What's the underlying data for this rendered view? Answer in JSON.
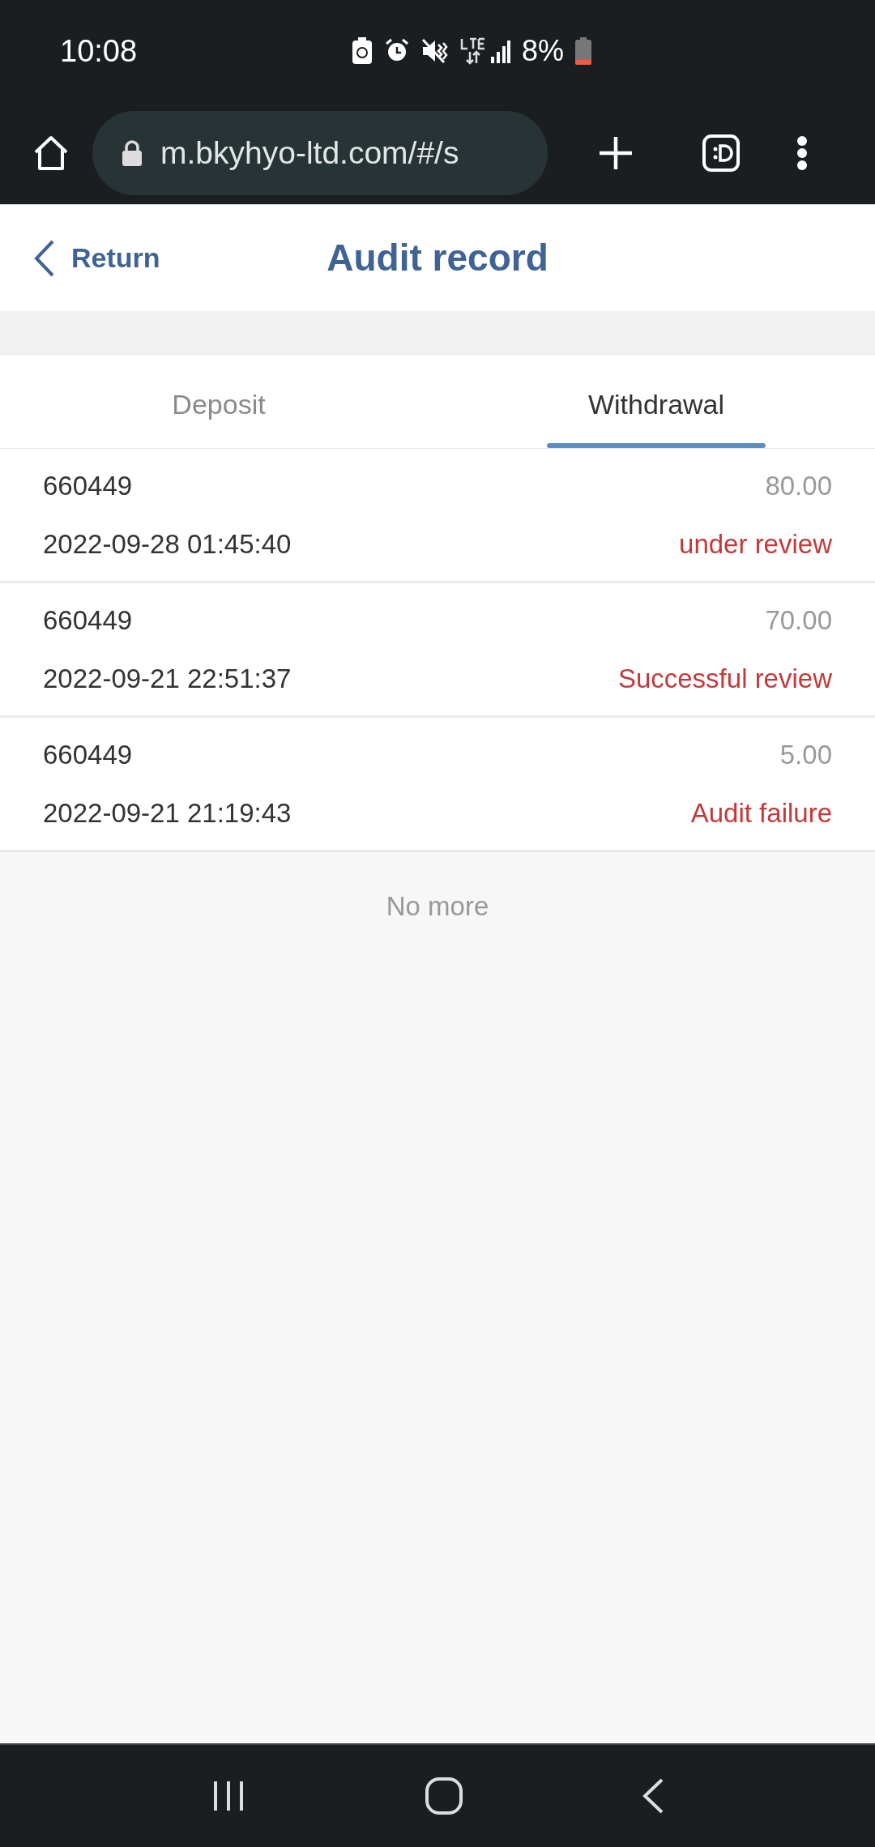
{
  "status_bar": {
    "time": "10:08",
    "battery": "8%"
  },
  "browser": {
    "url": "m.bkyhyo-ltd.com/#/s"
  },
  "header": {
    "back": "Return",
    "title": "Audit record"
  },
  "tabs": [
    {
      "label": "Deposit",
      "selected": false
    },
    {
      "label": "Withdrawal",
      "selected": true
    }
  ],
  "records": [
    {
      "id": "660449",
      "time": "2022-09-28 01:45:40",
      "amount": "80.00",
      "status": "under review"
    },
    {
      "id": "660449",
      "time": "2022-09-21 22:51:37",
      "amount": "70.00",
      "status": "Successful review"
    },
    {
      "id": "660449",
      "time": "2022-09-21 21:19:43",
      "amount": "5.00",
      "status": "Audit failure"
    }
  ],
  "footer": "No more"
}
